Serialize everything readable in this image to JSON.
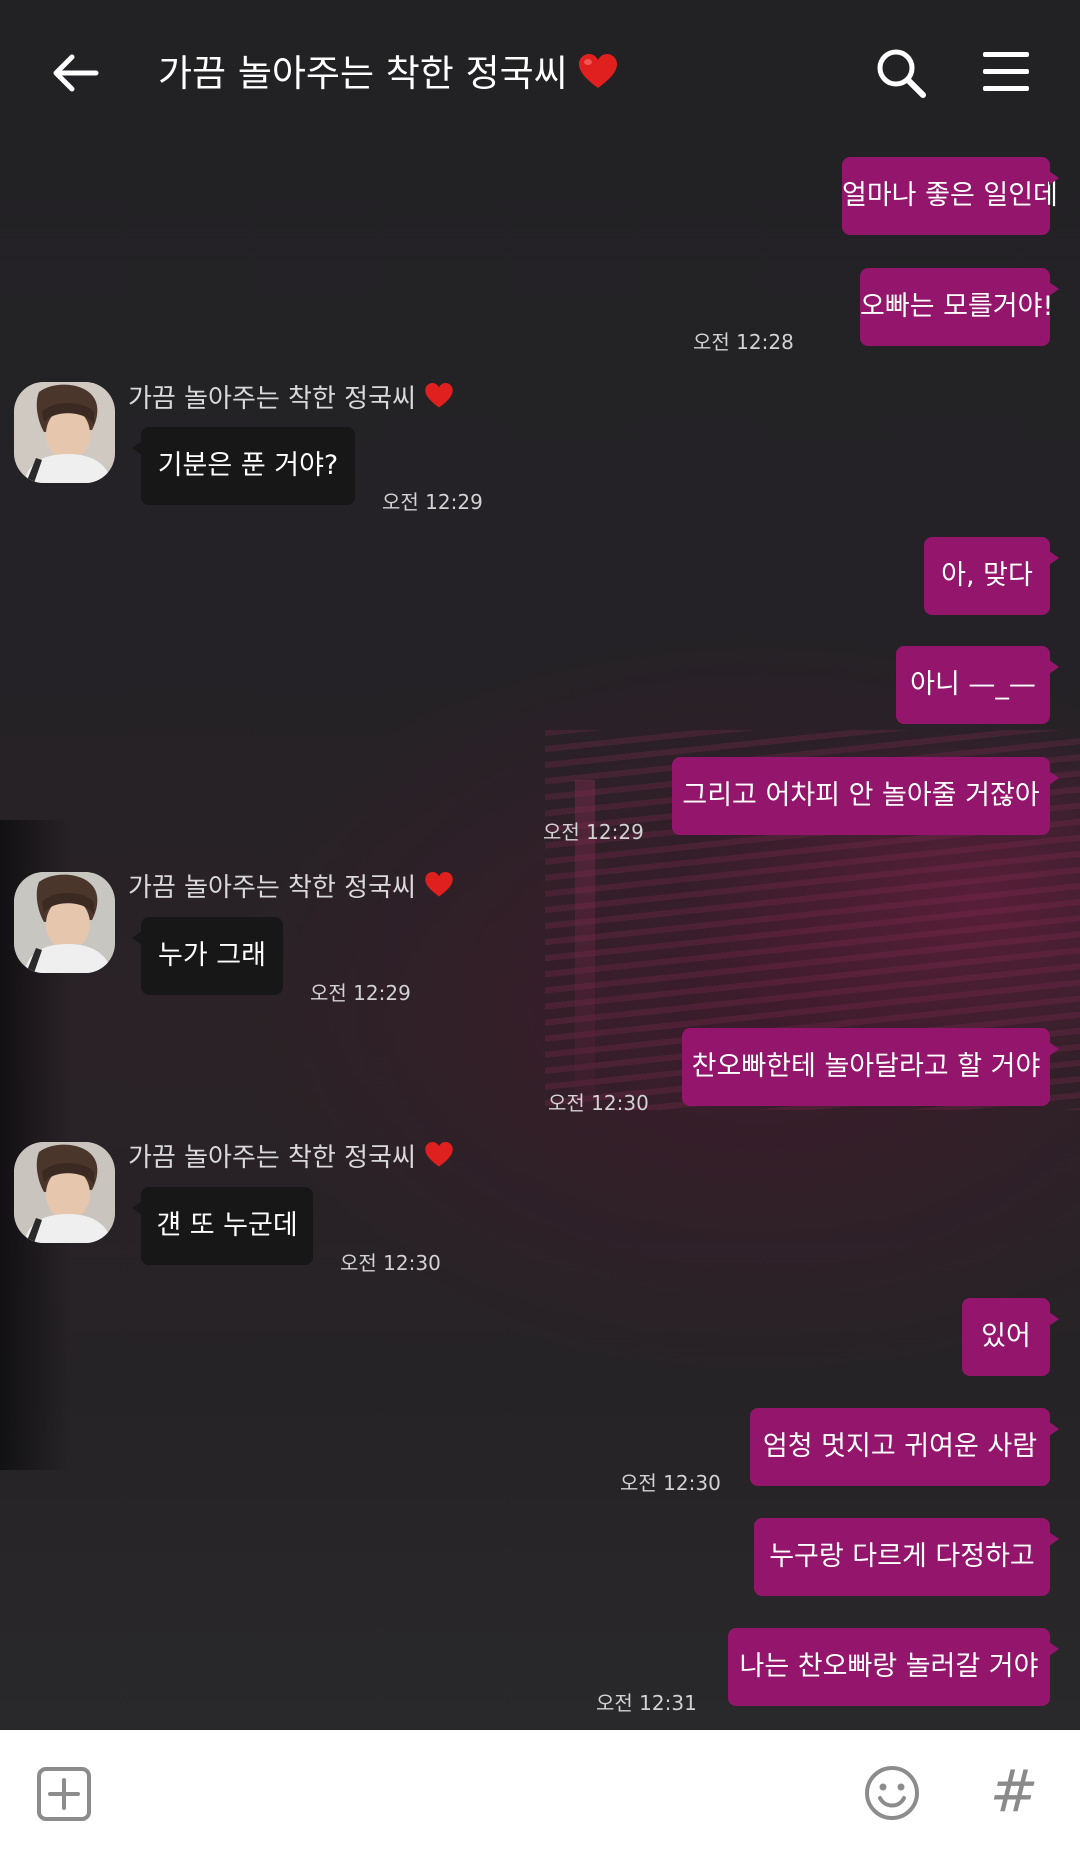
{
  "header": {
    "title": "가끔 놀아주는 착한 정국씨",
    "title_heart": "❤️"
  },
  "messages": [
    {
      "from": "me",
      "text": "얼마나 좋은 일인데",
      "time": ""
    },
    {
      "from": "me",
      "text": "오빠는 모를거야!",
      "time": "오전 12:28"
    },
    {
      "from": "them",
      "sender": "가끔 놀아주는 착한 정국씨",
      "text": "기분은 푼 거야?",
      "time": "오전 12:29"
    },
    {
      "from": "me",
      "text": "아, 맞다",
      "time": ""
    },
    {
      "from": "me",
      "text": "아니 —_—",
      "time": ""
    },
    {
      "from": "me",
      "text": "그리고 어차피 안 놀아줄 거잖아",
      "time": "오전 12:29"
    },
    {
      "from": "them",
      "sender": "가끔 놀아주는 착한 정국씨",
      "text": "누가 그래",
      "time": "오전 12:29"
    },
    {
      "from": "me",
      "text": "찬오빠한테 놀아달라고 할 거야",
      "time": "오전 12:30"
    },
    {
      "from": "them",
      "sender": "가끔 놀아주는 착한 정국씨",
      "text": "걘 또 누군데",
      "time": "오전 12:30"
    },
    {
      "from": "me",
      "text": "있어",
      "time": ""
    },
    {
      "from": "me",
      "text": "엄청 멋지고 귀여운 사람",
      "time": "오전 12:30"
    },
    {
      "from": "me",
      "text": "누구랑 다르게 다정하고",
      "time": ""
    },
    {
      "from": "me",
      "text": "나는 찬오빠랑 놀러갈 거야",
      "time": "오전 12:31"
    }
  ],
  "colors": {
    "my_bubble": "#93166c",
    "their_bubble": "#171717",
    "background": "#242226",
    "footer": "#ffffff"
  },
  "footer": {
    "add_icon": "plus-square-icon",
    "emoji_icon": "smiley-icon",
    "hash_label": "#"
  }
}
